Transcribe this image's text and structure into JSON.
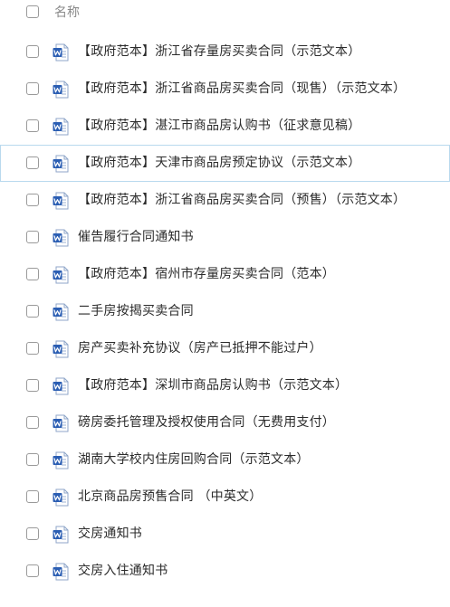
{
  "header": {
    "name_column_label": "名称"
  },
  "files": [
    {
      "name": "【政府范本】浙江省存量房买卖合同（示范文本）",
      "icon": "word-doc-icon",
      "selected": false
    },
    {
      "name": "【政府范本】浙江省商品房买卖合同（现售）（示范文本）",
      "icon": "word-doc-icon",
      "selected": false
    },
    {
      "name": "【政府范本】湛江市商品房认购书（征求意见稿）",
      "icon": "word-doc-icon",
      "selected": false
    },
    {
      "name": "【政府范本】天津市商品房预定协议（示范文本）",
      "icon": "word-doc-icon",
      "selected": true
    },
    {
      "name": "【政府范本】浙江省商品房买卖合同（预售）（示范文本）",
      "icon": "word-doc-icon",
      "selected": false
    },
    {
      "name": "催告履行合同通知书",
      "icon": "word-doc-icon",
      "selected": false
    },
    {
      "name": "【政府范本】宿州市存量房买卖合同（范本）",
      "icon": "word-doc-icon",
      "selected": false
    },
    {
      "name": "二手房按揭买卖合同",
      "icon": "word-doc-icon",
      "selected": false
    },
    {
      "name": "房产买卖补充协议（房产已抵押不能过户）",
      "icon": "word-doc-icon",
      "selected": false
    },
    {
      "name": "【政府范本】深圳市商品房认购书（示范文本）",
      "icon": "word-doc-icon",
      "selected": false
    },
    {
      "name": "磅房委托管理及授权使用合同（无费用支付）",
      "icon": "word-doc-icon",
      "selected": false
    },
    {
      "name": "湖南大学校内住房回购合同（示范文本）",
      "icon": "word-doc-icon",
      "selected": false
    },
    {
      "name": "北京商品房预售合同 （中英文）",
      "icon": "word-doc-icon",
      "selected": false
    },
    {
      "name": "交房通知书",
      "icon": "word-doc-icon",
      "selected": false
    },
    {
      "name": "交房入住通知书",
      "icon": "word-doc-icon",
      "selected": false
    }
  ],
  "colors": {
    "word_icon_blue": "#2b5eb3",
    "selected_row_border": "#b9d9ee",
    "text": "#2b2b2b",
    "header_text": "#8a8a8a"
  }
}
